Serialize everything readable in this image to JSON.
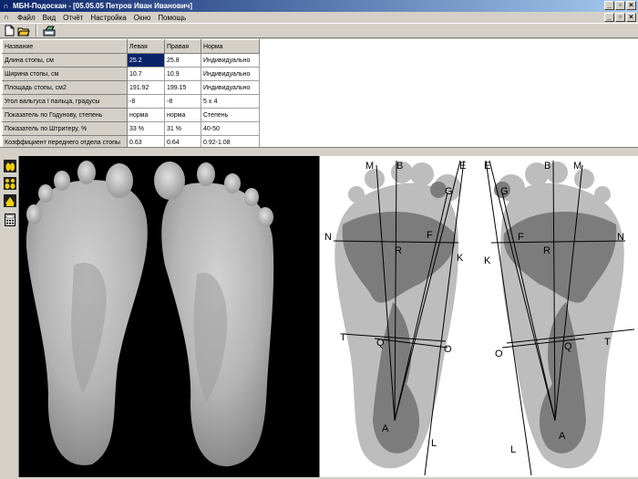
{
  "window": {
    "title": "МБН-Подоскан - [05.05.05 Петров Иван Иванович]",
    "buttons": [
      "_",
      "▫",
      "×"
    ]
  },
  "menu": {
    "items": [
      "Файл",
      "Вид",
      "Отчёт",
      "Настройка",
      "Окно",
      "Помощь"
    ]
  },
  "toolbar": {
    "icons": [
      "new-document-icon",
      "open-folder-icon",
      "scanner-icon"
    ]
  },
  "table": {
    "headers": [
      "Название",
      "Левая",
      "Правая",
      "Норма"
    ],
    "rows": [
      [
        "Длина стопы, см",
        "25.2",
        "25.8",
        "Индивидуально"
      ],
      [
        "Ширина стопы, см",
        "10.7",
        "10.9",
        "Индивидуально"
      ],
      [
        "Площадь стопы, см2",
        "191.92",
        "199.15",
        "Индивидуально"
      ],
      [
        "Угол вальгуса I пальца, градусы",
        "-8",
        "-8",
        "5 ± 4"
      ],
      [
        "Показатель по Годунову, степень",
        "норма",
        "норма",
        "Степень"
      ],
      [
        "Показатель по Штритеру, %",
        "33 %",
        "31 %",
        "40-50"
      ],
      [
        "Коэффициент переднего отдела стопы",
        "0.63",
        "0.64",
        "0.92-1.08"
      ]
    ]
  },
  "side_tools": {
    "icons": [
      "foot-scan-icon",
      "both-feet-icon",
      "feet-compare-icon",
      "calculator-icon"
    ]
  },
  "diagram": {
    "left_labels": [
      "M",
      "B",
      "E",
      "G",
      "N",
      "R",
      "F",
      "K",
      "T",
      "Q",
      "O",
      "A",
      "L"
    ],
    "right_labels": [
      "E",
      "B",
      "M",
      "G",
      "F",
      "R",
      "N",
      "K",
      "O",
      "Q",
      "T",
      "A",
      "L"
    ]
  },
  "colors": {
    "title_start": "#0a246a",
    "title_end": "#a6caf0",
    "selection": "#0a246a",
    "chrome": "#d4d0c8",
    "foot_light": "#bdbdbd",
    "foot_dark": "#7c7c7c"
  }
}
